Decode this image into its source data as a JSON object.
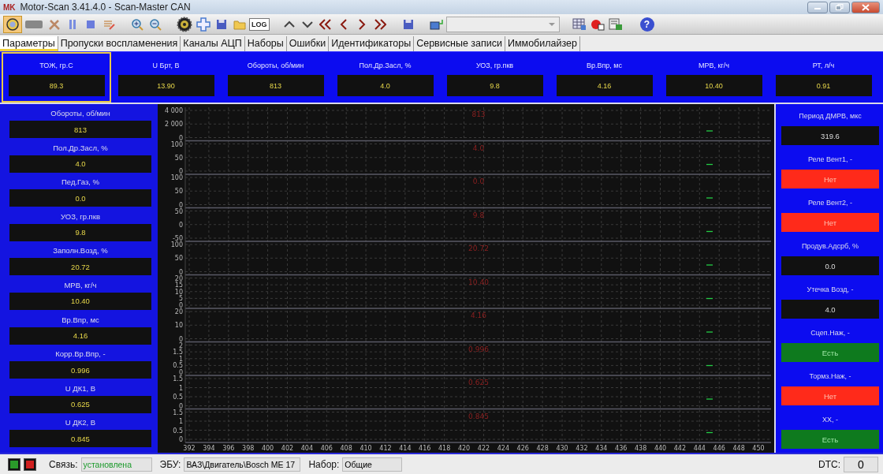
{
  "window": {
    "title": "Motor-Scan 3.41.4.0 - Scan-Master CAN",
    "logo": "MK"
  },
  "toolbar": {
    "connect_pressed": true,
    "log_label": "LOG",
    "help_glyph": "?"
  },
  "tabs": [
    {
      "label": "Параметры",
      "selected": true
    },
    {
      "label": "Пропуски воспламенения",
      "selected": false
    },
    {
      "label": "Каналы АЦП",
      "selected": false
    },
    {
      "label": "Наборы",
      "selected": false
    },
    {
      "label": "Ошибки",
      "selected": false
    },
    {
      "label": "Идентификаторы",
      "selected": false
    },
    {
      "label": "Сервисные записи",
      "selected": false
    },
    {
      "label": "Иммобилайзер",
      "selected": false
    }
  ],
  "top_gauges": [
    {
      "label": "ТОЖ, гр.С",
      "value": "89.3",
      "selected": true
    },
    {
      "label": "U Брт, В",
      "value": "13.90",
      "selected": false
    },
    {
      "label": "Обороты, об/мин",
      "value": "813",
      "selected": false
    },
    {
      "label": "Пол.Др.Засл, %",
      "value": "4.0",
      "selected": false
    },
    {
      "label": "УОЗ, гр.пкв",
      "value": "9.8",
      "selected": false
    },
    {
      "label": "Вр.Впр, мс",
      "value": "4.16",
      "selected": false
    },
    {
      "label": "МРВ, кг/ч",
      "value": "10.40",
      "selected": false
    },
    {
      "label": "РТ, л/ч",
      "value": "0.91",
      "selected": false
    }
  ],
  "left_gauges": [
    {
      "label": "Обороты, об/мин",
      "value": "813"
    },
    {
      "label": "Пол.Др.Засл, %",
      "value": "4.0"
    },
    {
      "label": "Пед.Газ, %",
      "value": "0.0"
    },
    {
      "label": "УОЗ, гр.пкв",
      "value": "9.8"
    },
    {
      "label": "Заполн.Возд, %",
      "value": "20.72"
    },
    {
      "label": "МРВ, кг/ч",
      "value": "10.40"
    },
    {
      "label": "Вр.Впр, мс",
      "value": "4.16"
    },
    {
      "label": "Корр.Вр.Впр, -",
      "value": "0.996"
    },
    {
      "label": "U ДК1, В",
      "value": "0.625"
    },
    {
      "label": "U ДК2, В",
      "value": "0.845"
    }
  ],
  "chart": {
    "xticks": [
      "392",
      "394",
      "396",
      "398",
      "400",
      "402",
      "404",
      "406",
      "408",
      "410",
      "412",
      "414",
      "416",
      "418",
      "420",
      "422",
      "424",
      "426",
      "428",
      "430",
      "432",
      "434",
      "436",
      "438",
      "440",
      "442",
      "444",
      "446",
      "448",
      "450"
    ],
    "strips": [
      {
        "value_label": "813",
        "yticks": [
          "4 000",
          "2 000",
          "0"
        ]
      },
      {
        "value_label": "4.0",
        "yticks": [
          "100",
          "50",
          "0"
        ]
      },
      {
        "value_label": "0.0",
        "yticks": [
          "100",
          "50",
          "0"
        ]
      },
      {
        "value_label": "9.8",
        "yticks": [
          "50",
          "0",
          "-50"
        ]
      },
      {
        "value_label": "20.72",
        "yticks": [
          "100",
          "50",
          "0"
        ]
      },
      {
        "value_label": "10.40",
        "yticks": [
          "20",
          "15",
          "10",
          "5",
          "0"
        ]
      },
      {
        "value_label": "4.16",
        "yticks": [
          "20",
          "10",
          "0"
        ]
      },
      {
        "value_label": "0.996",
        "yticks": [
          "2",
          "1.5",
          "1",
          "0.5",
          "0"
        ]
      },
      {
        "value_label": "0.625",
        "yticks": [
          "1.5",
          "1",
          "0.5",
          "0"
        ]
      },
      {
        "value_label": "0.845",
        "yticks": [
          "1.5",
          "1",
          "0.5",
          "0"
        ]
      }
    ]
  },
  "right_gauges": [
    {
      "label": "Период ДМРВ, мкс",
      "value": "319.6",
      "kind": "value"
    },
    {
      "label": "Реле Вент1, -",
      "value": "Нет",
      "kind": "indicator",
      "active": false
    },
    {
      "label": "Реле Вент2, -",
      "value": "Нет",
      "kind": "indicator",
      "active": false
    },
    {
      "label": "Продув.Адсрб, %",
      "value": "0.0",
      "kind": "value"
    },
    {
      "label": "Утечка Возд, -",
      "value": "4.0",
      "kind": "value"
    },
    {
      "label": "Сцеп.Наж, -",
      "value": "Есть",
      "kind": "indicator",
      "active": true
    },
    {
      "label": "Тормз.Наж, -",
      "value": "Нет",
      "kind": "indicator",
      "active": false
    },
    {
      "label": "XX, -",
      "value": "Есть",
      "kind": "indicator",
      "active": true
    }
  ],
  "status_bar": {
    "link_label": "Связь:",
    "link_value": "установлена",
    "ecu_label": "ЭБУ:",
    "ecu_value": "ВАЗ\\Двигатель\\Bosch ME 17",
    "set_label": "Набор:",
    "set_value": "Общие",
    "dtc_label": "DTC:",
    "dtc_value": "0"
  }
}
